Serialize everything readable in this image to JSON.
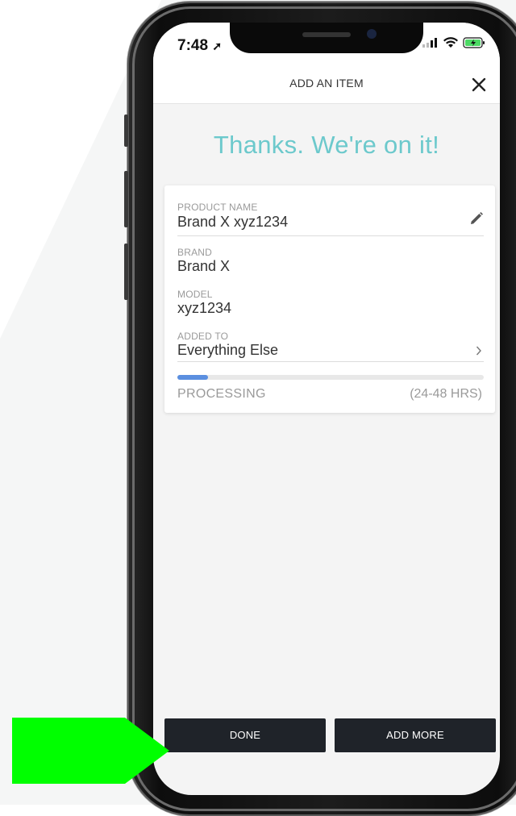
{
  "status_bar": {
    "time": "7:48"
  },
  "header": {
    "title": "ADD AN ITEM",
    "close_icon": "close-icon"
  },
  "headline": "Thanks. We're on it!",
  "item": {
    "product_name": {
      "label": "PRODUCT NAME",
      "value": "Brand X xyz1234",
      "icon": "pencil-icon"
    },
    "brand": {
      "label": "BRAND",
      "value": "Brand X"
    },
    "model": {
      "label": "MODEL",
      "value": "xyz1234"
    },
    "added_to": {
      "label": "ADDED TO",
      "value": "Everything Else",
      "icon": "chevron-right-icon"
    },
    "progress": {
      "fraction": 0.1,
      "status": "PROCESSING",
      "eta": "(24-48 HRS)"
    }
  },
  "buttons": {
    "done": "DONE",
    "add_more": "ADD MORE"
  },
  "colors": {
    "accent": "#6cc9cc",
    "progress": "#5b8fe0",
    "button_bg": "#1f2329",
    "highlight_arrow": "#00ff00"
  }
}
